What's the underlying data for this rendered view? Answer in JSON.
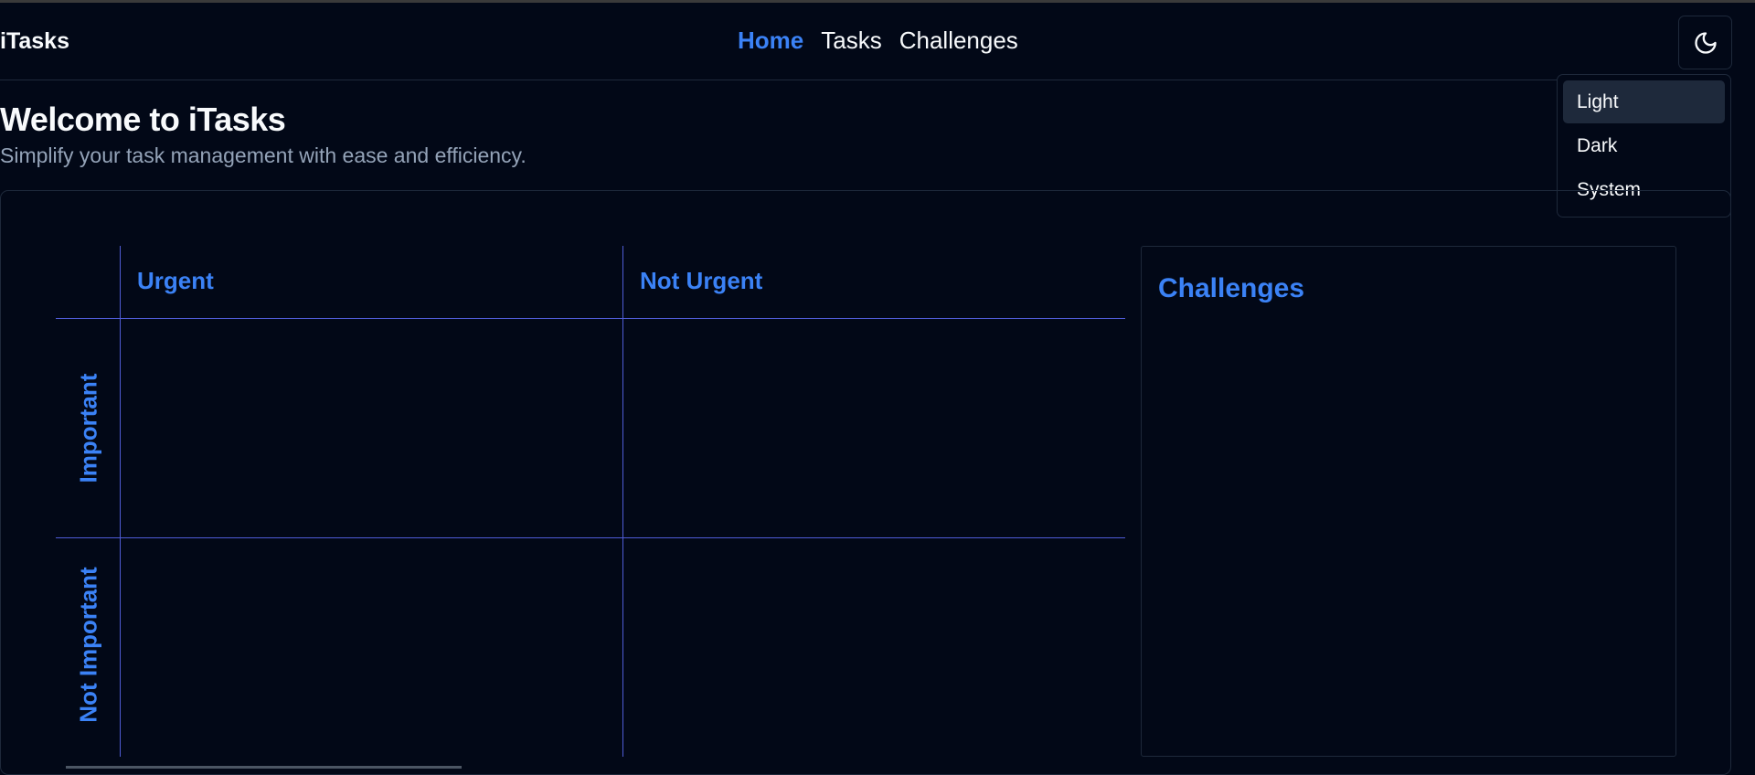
{
  "app": {
    "name": "iTasks"
  },
  "nav": {
    "items": [
      {
        "label": "Home",
        "active": true
      },
      {
        "label": "Tasks",
        "active": false
      },
      {
        "label": "Challenges",
        "active": false
      }
    ]
  },
  "theme_toggle": {
    "icon": "moon-icon"
  },
  "theme_menu": {
    "items": [
      {
        "label": "Light",
        "highlighted": true
      },
      {
        "label": "Dark",
        "highlighted": false
      },
      {
        "label": "System",
        "highlighted": false
      }
    ]
  },
  "hero": {
    "title": "Welcome to iTasks",
    "subtitle": "Simplify your task management with ease and efficiency."
  },
  "matrix": {
    "columns": [
      "Urgent",
      "Not Urgent"
    ],
    "rows": [
      "Important",
      "Not Important"
    ]
  },
  "challenges": {
    "title": "Challenges"
  },
  "colors": {
    "background": "#020817",
    "accent": "#3b82f6",
    "border": "#1e293b",
    "matrix_line": "#4f5bd5",
    "muted_text": "#94a3b8"
  }
}
